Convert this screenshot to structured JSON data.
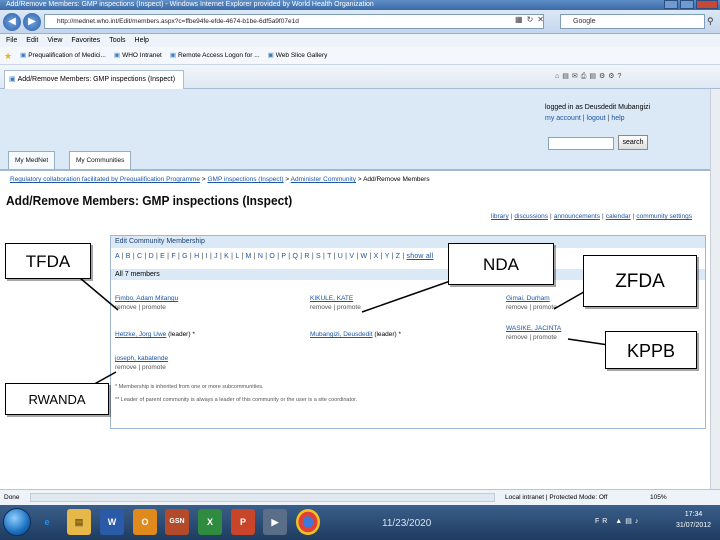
{
  "browser": {
    "title": "Add/Remove Members: GMP inspections (Inspect) - Windows Internet Explorer provided by World Health Organization",
    "url": "http://mednet.who.int/Edit/members.aspx?c=ffbe94fe-efde-4674-b1be-6df5a9f07e1d",
    "search_engine": "Google",
    "menu": [
      "File",
      "Edit",
      "View",
      "Favorites",
      "Tools",
      "Help"
    ],
    "favorites": [
      "Prequalification of Medici...",
      "WHO Intranet",
      "Remote Access Logon for ...",
      "Web Slice Gallery"
    ],
    "tab_title": "Add/Remove Members: GMP inspections (Inspect)",
    "status": "Done",
    "zone": "Local intranet | Protected Mode: Off",
    "zoom": "105%"
  },
  "site": {
    "logged_in_as": "logged in as Deusdedit Mubangizi",
    "user_links": [
      "my account",
      "logout",
      "help"
    ],
    "search_button": "search",
    "tabs": [
      "My MedNet",
      "My Communities"
    ]
  },
  "breadcrumb": {
    "items": [
      "Regulatory collaboration facilitated by Prequalification Programme",
      "GMP inspections (Inspect)",
      "Administer Community"
    ],
    "current": "Add/Remove Members"
  },
  "page": {
    "title": "Add/Remove Members: GMP inspections (Inspect)",
    "sub_links": [
      "library",
      "discussions",
      "announcements",
      "calendar",
      "community settings"
    ]
  },
  "panel": {
    "heading": "Edit Community Membership",
    "letters": [
      "A",
      "B",
      "C",
      "D",
      "E",
      "F",
      "G",
      "H",
      "I",
      "J",
      "K",
      "L",
      "M",
      "N",
      "O",
      "P",
      "Q",
      "R",
      "S",
      "T",
      "U",
      "V",
      "W",
      "X",
      "Y",
      "Z"
    ],
    "show_all": "show all",
    "count": "All 7 members",
    "actions": "remove | promote",
    "leader_tag": "(leader) *",
    "members": [
      {
        "name": "Fimbo, Adam Mitangu",
        "leader": false
      },
      {
        "name": "KIKULE, KATE",
        "leader": false
      },
      {
        "name": "Gimai, Durham",
        "leader": false
      },
      {
        "name": "Hetzke, Jorg Uwe",
        "leader": true
      },
      {
        "name": "Mubangizi, Deusdedit",
        "leader": true
      },
      {
        "name": "WASIKE, JACINTA",
        "leader": false
      },
      {
        "name": "joseph, kabatende",
        "leader": false
      }
    ],
    "notes": [
      "* Membership is inherited from one or more subcommunities.",
      "** Leader of parent community is always a leader of this community or the user is a site coordinator."
    ]
  },
  "callouts": {
    "tfda": "TFDA",
    "nda": "NDA",
    "zfda": "ZFDA",
    "kppb": "KPPB",
    "rwanda": "RWANDA"
  },
  "taskbar": {
    "date_center": "11/23/2020",
    "lang": "FR",
    "time": "17:34",
    "date": "31/07/2012"
  },
  "colors": {
    "link": "#1b55a8",
    "header_band": "#dbe9f6"
  }
}
